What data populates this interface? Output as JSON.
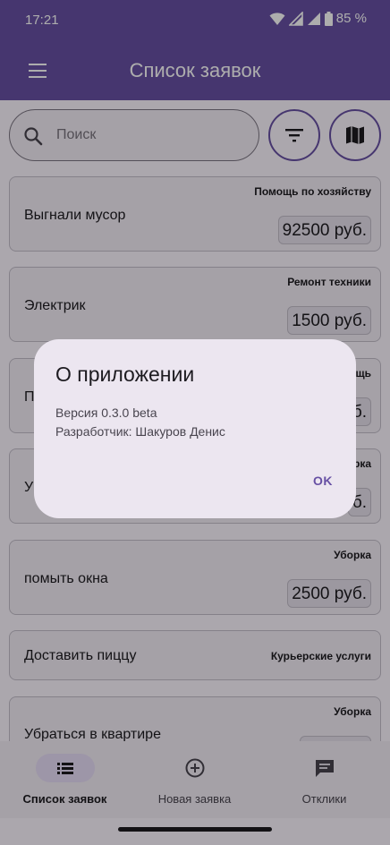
{
  "status": {
    "time": "17:21",
    "battery": "85 %"
  },
  "appbar": {
    "title": "Список заявок"
  },
  "search": {
    "placeholder": "Поиск"
  },
  "cards": [
    {
      "title": "Выгнали мусор",
      "category": "Помощь по хозяйству",
      "price": "92500 руб."
    },
    {
      "title": "Электрик",
      "category": "Ремонт техники",
      "price": "1500 руб."
    },
    {
      "title": "П",
      "category": "ощь",
      "price": "б."
    },
    {
      "title": "У",
      "category": "рка",
      "price": "б."
    },
    {
      "title": "помыть окна",
      "category": "Уборка",
      "price": "2500 руб."
    },
    {
      "title": "Доставить пиццу",
      "category": "Курьерские услуги",
      "price": ""
    },
    {
      "title": "Убраться в квартире",
      "category": "Уборка",
      "price": ""
    }
  ],
  "dialog": {
    "title": "О приложении",
    "version": "Версия 0.3.0 beta",
    "developer": "Разработчик: Шакуров Денис",
    "ok": "OK"
  },
  "nav": [
    {
      "label": "Список заявок",
      "icon": "list-icon",
      "active": true
    },
    {
      "label": "Новая заявка",
      "icon": "add-circle-icon",
      "active": false
    },
    {
      "label": "Отклики",
      "icon": "chat-icon",
      "active": false
    }
  ],
  "colors": {
    "primary": "#6750a4",
    "surface": "#fdf7ff",
    "card": "#f3edf7",
    "scrim": "rgba(0,0,0,0.32)"
  }
}
